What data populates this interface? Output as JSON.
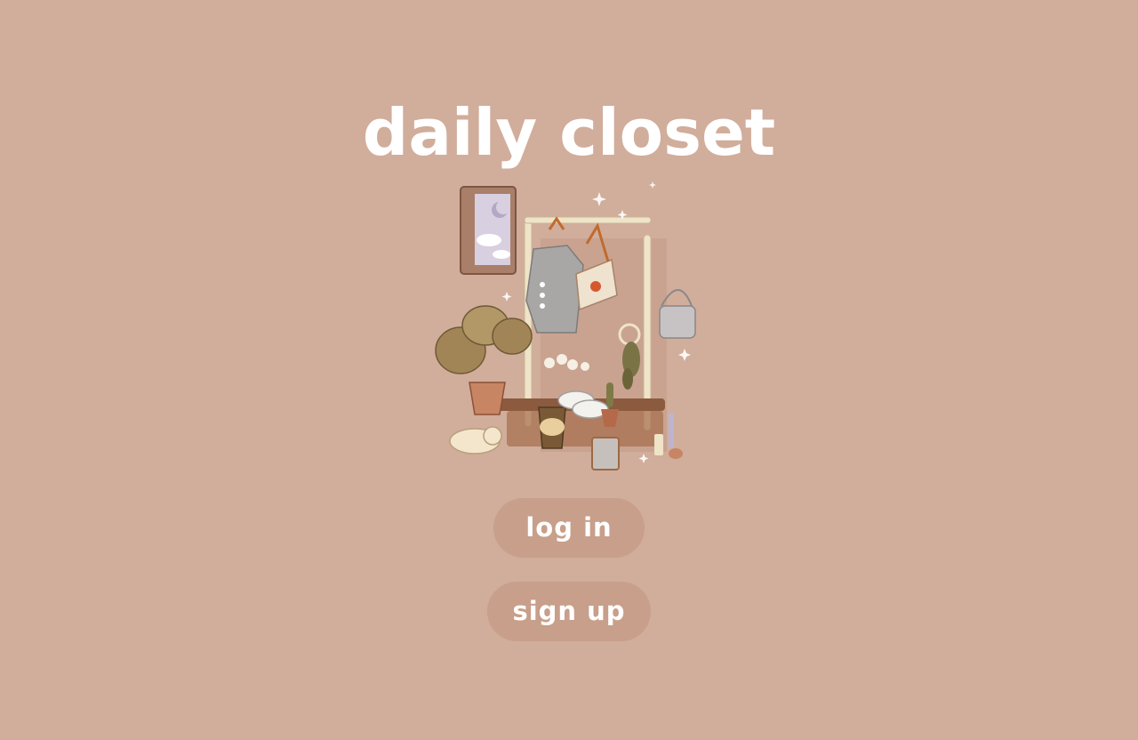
{
  "app": {
    "title": "daily closet"
  },
  "illustration": {
    "icon": "closet-room-illustration"
  },
  "actions": {
    "login_label": "log in",
    "signup_label": "sign up"
  },
  "colors": {
    "background": "#d1ad9b",
    "button": "#c89f8a",
    "text": "#ffffff"
  }
}
